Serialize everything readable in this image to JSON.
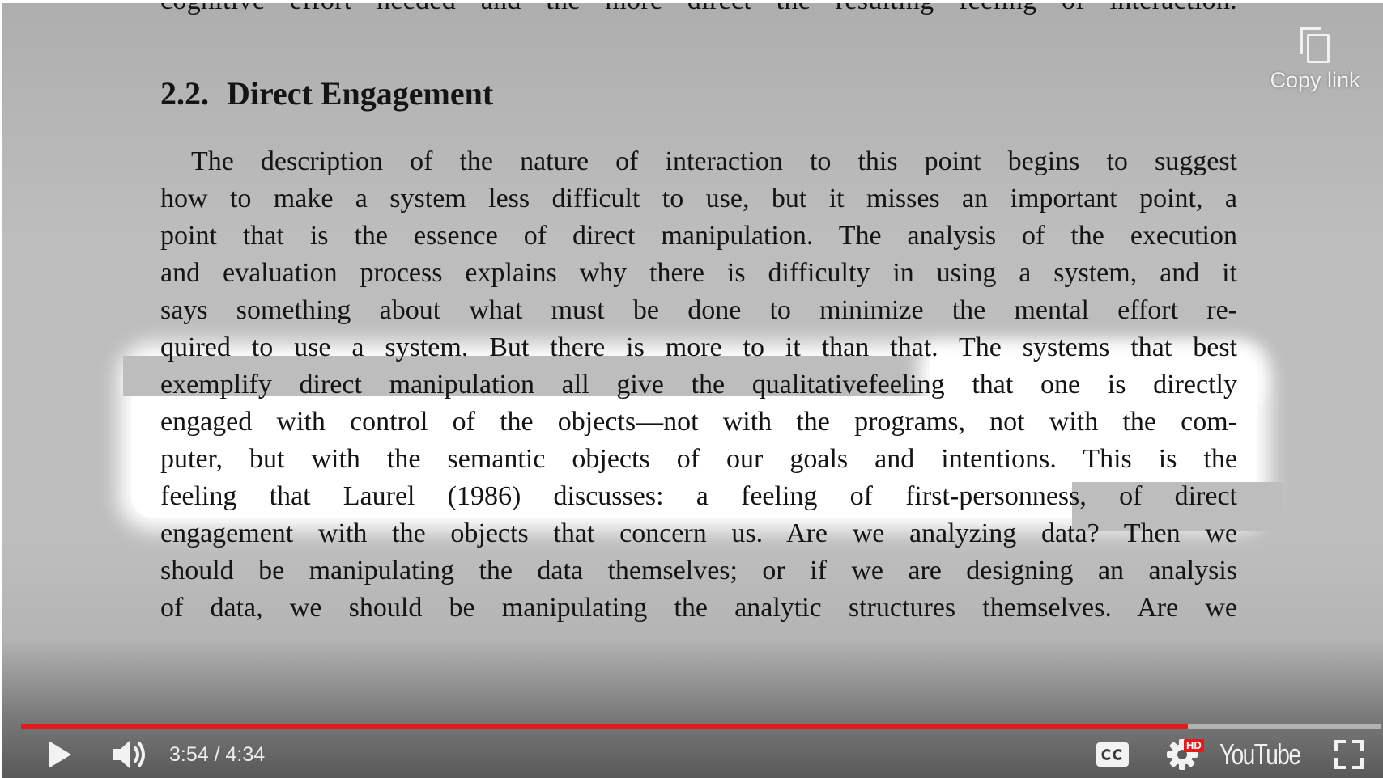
{
  "video": {
    "cut_off_line": "cognitive effort needed and the more direct the resulting feeling of interaction.",
    "heading_number": "2.2.",
    "heading_title": "Direct Engagement",
    "paragraph_lines": [
      "The description of the nature of interaction to this point begins to suggest",
      "how to make a system less difficult to use, but it misses an important point, a",
      "point that is the essence of direct manipulation. The analysis of the execution",
      "and evaluation process explains why there is difficulty in using a system, and it",
      "says something about what must be done to minimize the mental effort re-",
      "quired to use a system. But there is more to it than that. The systems that best",
      "exemplify direct manipulation all give the qualitativefeeling that one is directly",
      "engaged with control of the objects—not with the programs, not with the com-",
      "puter, but with the semantic objects of our goals and intentions. This is the",
      "feeling that Laurel (1986) discusses: a feeling of first-personness, of direct",
      "engagement with the objects that concern us. Are we analyzing data? Then we",
      "should be manipulating the data themselves; or if we are designing an analysis",
      "of data, we should be manipulating the analytic structures themselves. Are we"
    ]
  },
  "overlay": {
    "copy_link_label": "Copy link",
    "copy_icon": "copy-icon"
  },
  "player": {
    "current_time": "3:54",
    "duration": "4:34",
    "time_display": "3:54 / 4:34",
    "progress_fraction": 0.8577,
    "hd_badge": "HD",
    "logo_text": "YouTube",
    "accent_color": "#e51a1a",
    "icons": [
      "play-icon",
      "volume-icon",
      "captions-icon",
      "settings-gear-icon",
      "youtube-logo",
      "fullscreen-icon"
    ]
  }
}
